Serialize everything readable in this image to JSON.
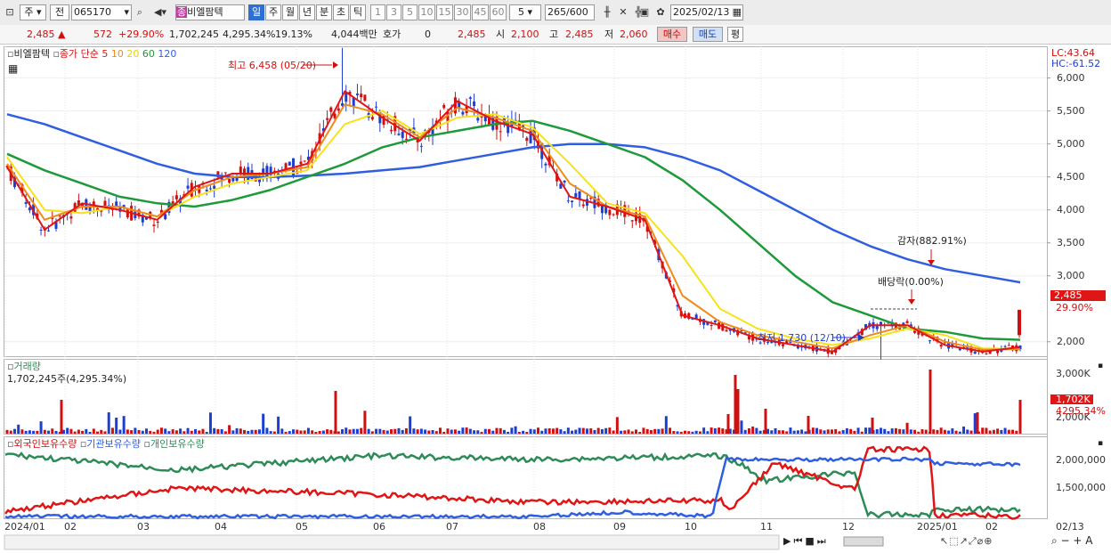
{
  "toolbar": {
    "market": "주",
    "prev": "전",
    "code": "065170",
    "stock_badge": "종",
    "stock_name": "비엘팜텍",
    "periods": [
      "일",
      "주",
      "월",
      "년",
      "분",
      "초",
      "틱"
    ],
    "selected_period": "일",
    "intervals": [
      "1",
      "3",
      "5",
      "10",
      "15",
      "30",
      "45",
      "60"
    ],
    "interval_value": "5",
    "count": "265",
    "count_total": "/600",
    "date": "2025/02/13"
  },
  "quote": {
    "price": "2,485",
    "change": "572",
    "change_pct": "+29.90%",
    "volume": "1,702,245",
    "volume_pct": "4,295.34%",
    "turnover": "19.13%",
    "amount": "4,044백만",
    "hoga_label": "호가",
    "hoga_value": "0",
    "bid": "2,485",
    "open_label": "시",
    "open": "2,100",
    "high_label": "고",
    "high": "2,485",
    "low_label": "저",
    "low": "2,060",
    "buy_btn": "매수",
    "sell_btn": "매도",
    "eval_btn": "평"
  },
  "price_pane": {
    "legend_name": "비엘팜텍",
    "legend_ma": "종가 단순",
    "ma_periods": [
      "5",
      "10",
      "20",
      "60",
      "120"
    ],
    "lc": "LC:43.64",
    "hc": "HC:-61.52",
    "high_note": "최고 6,458 (05/20)",
    "low_note": "최저 1,730 (12/10)",
    "event_capital": "감자(882.91%)",
    "event_dividend": "배당락(0.00%)",
    "current_price": "2,485",
    "current_pct": "29.90%",
    "y_ticks": [
      "6,000",
      "5,500",
      "5,000",
      "4,500",
      "4,000",
      "3,500",
      "3,000",
      "2,000"
    ]
  },
  "volume_pane": {
    "title": "거래량",
    "summary": "1,702,245주(4,295.34%)",
    "y_ticks": [
      "3,000K",
      "2,000K"
    ],
    "current": "1,702K",
    "current_pct": "4295.34%"
  },
  "holdings_pane": {
    "legend": [
      "외국인보유수량",
      "기관보유수량",
      "개인보유수량"
    ],
    "y_ticks": [
      "2,000,000",
      "1,500,000"
    ]
  },
  "x_axis": [
    "2024/01",
    "02",
    "03",
    "04",
    "05",
    "06",
    "07",
    "08",
    "09",
    "10",
    "11",
    "12",
    "2025/01",
    "02"
  ],
  "x_right_label": "02/13",
  "colors": {
    "up": "#d01010",
    "down": "#1d3fd0",
    "ma5": "#e01515",
    "ma10": "#f08a1a",
    "ma20": "#f7e21a",
    "ma60": "#1e9a3a",
    "ma120": "#2f5fe0",
    "foreign": "#2e8b57",
    "institution": "#2f5fe0",
    "individual": "#e01515"
  },
  "chart_data": {
    "type": "candlestick",
    "x": [
      "2024/01",
      "02",
      "03",
      "04",
      "05",
      "06",
      "07",
      "08",
      "09",
      "10",
      "11",
      "12",
      "2025/01",
      "02/13"
    ],
    "series": [
      {
        "name": "5",
        "values": [
          4650,
          3700,
          4100,
          4000,
          3850,
          4350,
          4550,
          4550,
          4700,
          5800,
          5400,
          5050,
          5650,
          5350,
          5150,
          4200,
          4050,
          3850,
          2400,
          2250,
          2050,
          1950,
          1850,
          2250,
          2250,
          1950,
          1850,
          1920
        ]
      },
      {
        "name": "10",
        "values": [
          4700,
          3850,
          4050,
          4050,
          3900,
          4300,
          4500,
          4550,
          4650,
          5600,
          5450,
          5100,
          5550,
          5400,
          5200,
          4400,
          4050,
          3900,
          2700,
          2300,
          2100,
          2000,
          1900,
          2100,
          2250,
          2000,
          1880,
          1890
        ]
      },
      {
        "name": "20",
        "values": [
          4800,
          4000,
          3950,
          4050,
          3900,
          4200,
          4400,
          4500,
          4600,
          5300,
          5500,
          5150,
          5400,
          5450,
          5250,
          4700,
          4100,
          3950,
          3300,
          2500,
          2200,
          2050,
          1950,
          2050,
          2200,
          2100,
          1900,
          1890
        ]
      },
      {
        "name": "60",
        "values": [
          4850,
          4600,
          4400,
          4200,
          4100,
          4050,
          4150,
          4300,
          4500,
          4700,
          4950,
          5100,
          5200,
          5300,
          5350,
          5200,
          5000,
          4800,
          4450,
          4000,
          3500,
          3000,
          2600,
          2400,
          2200,
          2150,
          2050,
          2030
        ]
      },
      {
        "name": "120",
        "values": [
          5450,
          5300,
          5100,
          4900,
          4700,
          4550,
          4500,
          4500,
          4520,
          4550,
          4600,
          4650,
          4750,
          4850,
          4950,
          5000,
          5000,
          4950,
          4800,
          4600,
          4300,
          4000,
          3700,
          3450,
          3250,
          3100,
          3000,
          2900
        ]
      }
    ],
    "price_range": [
      1700,
      6400
    ],
    "high": {
      "label": "최고 6,458 (05/20)",
      "value": 6458
    },
    "low": {
      "label": "최저 1,730 (12/10)",
      "value": 1730
    },
    "last": {
      "close": 2485,
      "open": 2100,
      "high": 2485,
      "low": 2060,
      "volume": 1702245
    }
  }
}
